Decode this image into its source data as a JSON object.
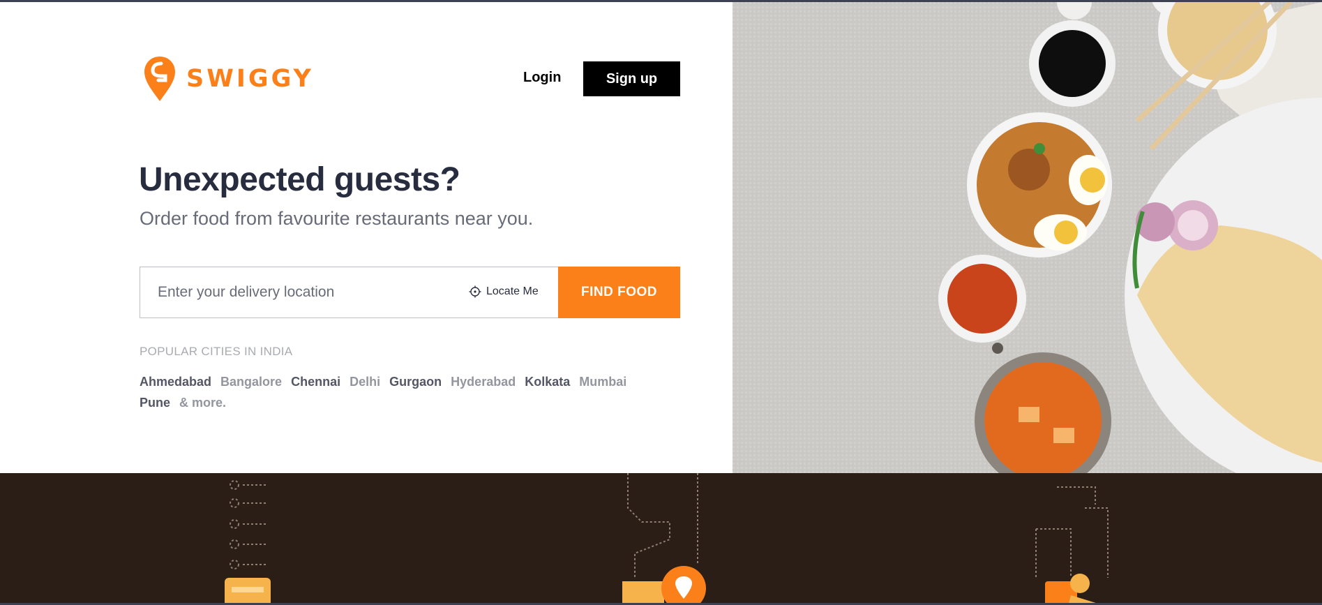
{
  "brand": {
    "name": "SWIGGY",
    "color": "#fc8019"
  },
  "header": {
    "login_label": "Login",
    "signup_label": "Sign up"
  },
  "hero": {
    "title": "Unexpected guests?",
    "subtitle": "Order food from favourite restaurants near you."
  },
  "search": {
    "placeholder": "Enter your delivery location",
    "value": "",
    "locate_label": "Locate Me",
    "locate_icon": "crosshair-icon",
    "submit_label": "FIND FOOD"
  },
  "cities": {
    "title": "POPULAR CITIES IN INDIA",
    "items": [
      {
        "label": "Ahmedabad",
        "tone": "dark"
      },
      {
        "label": "Bangalore",
        "tone": "light"
      },
      {
        "label": "Chennai",
        "tone": "dark"
      },
      {
        "label": "Delhi",
        "tone": "light"
      },
      {
        "label": "Gurgaon",
        "tone": "dark"
      },
      {
        "label": "Hyderabad",
        "tone": "light"
      },
      {
        "label": "Kolkata",
        "tone": "dark"
      },
      {
        "label": "Mumbai",
        "tone": "light"
      },
      {
        "label": "Pune",
        "tone": "dark"
      },
      {
        "label": "& more.",
        "tone": "light"
      }
    ]
  },
  "footer": {
    "background": "#2b1e16"
  }
}
